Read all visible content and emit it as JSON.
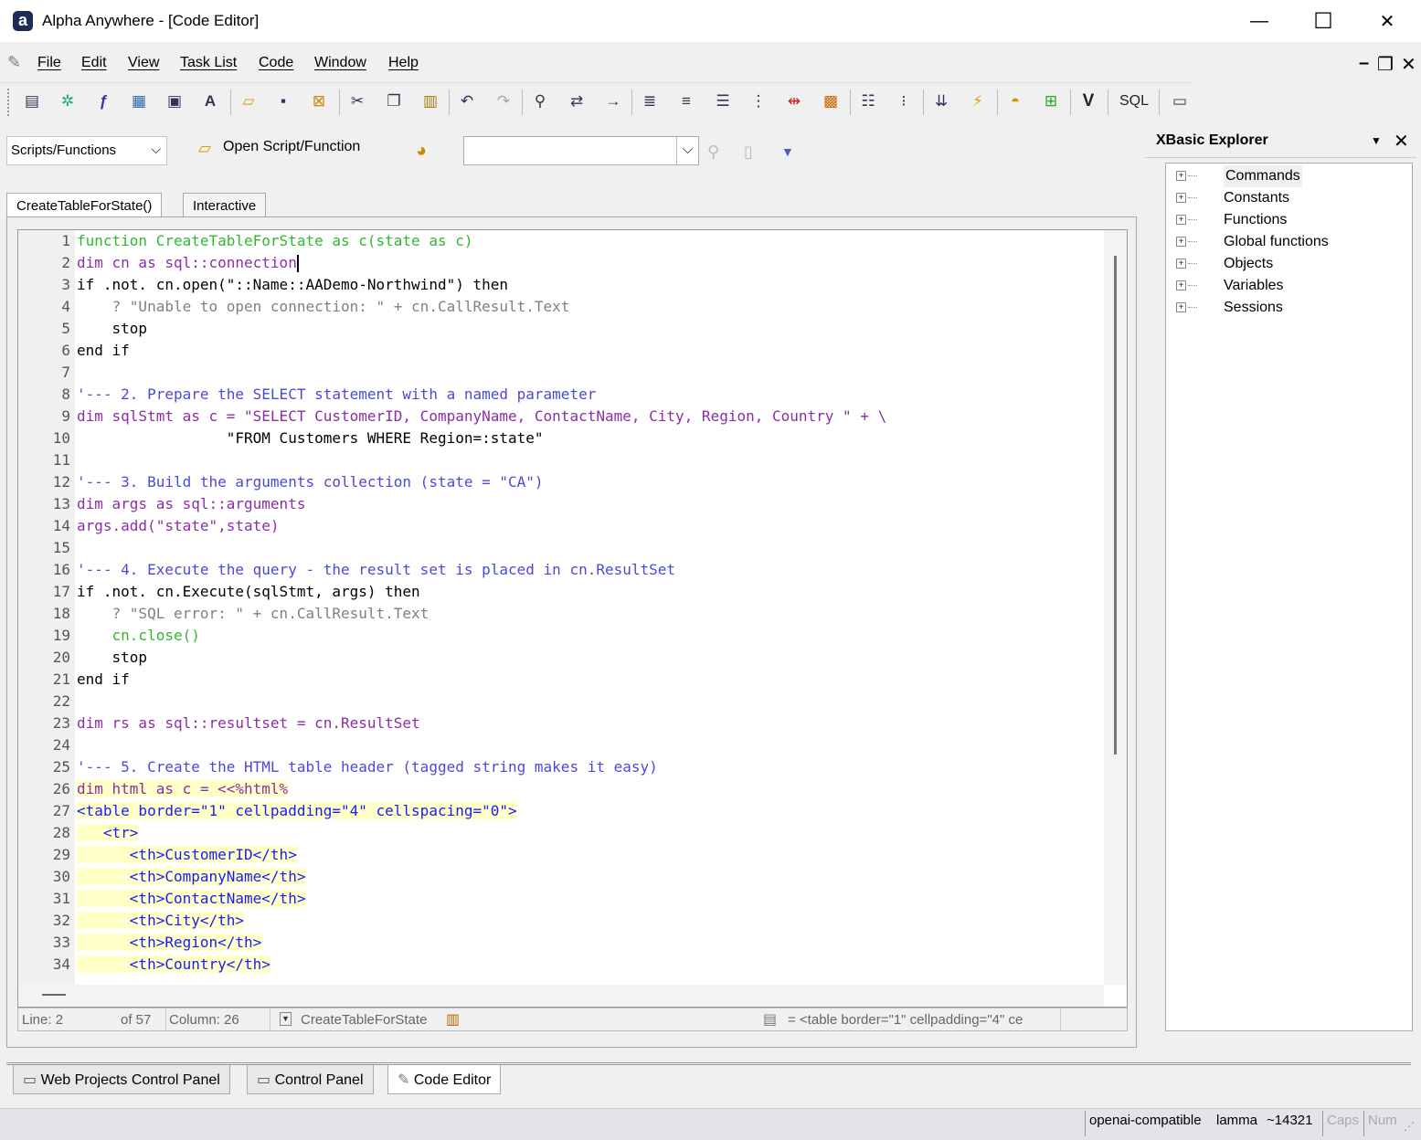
{
  "window": {
    "title": "Alpha Anywhere - [Code Editor]",
    "minimize_glyph": "—",
    "maximize_glyph": "☐",
    "close_glyph": "✕"
  },
  "menu": {
    "items": [
      {
        "label": "File"
      },
      {
        "label": "Edit"
      },
      {
        "label": "View"
      },
      {
        "label": "Task List"
      },
      {
        "label": "Code"
      },
      {
        "label": "Window"
      },
      {
        "label": "Help"
      }
    ],
    "mdi_min": "–",
    "mdi_restore": "❐",
    "mdi_close": "✕"
  },
  "toolbar": {
    "icons": [
      "new-script-icon",
      "new-function-icon",
      "function-icon",
      "class-icon",
      "properties-icon",
      "font-icon",
      "open-folder-icon",
      "save-icon",
      "save-close-icon",
      "cut-icon",
      "copy-icon",
      "paste-icon",
      "undo-icon",
      "redo-icon",
      "find-icon",
      "replace-icon",
      "goto-icon",
      "indent-icon",
      "outdent-icon",
      "format-icon",
      "align-right-icon",
      "split-icon",
      "tools-icon",
      "list-icon",
      "numbered-list-icon",
      "collapse-icon",
      "lightning-icon",
      "genie-icon",
      "add-icon",
      "verify-icon",
      "sql-icon",
      "window-icon"
    ],
    "v_label": "V",
    "sql_label": "SQL"
  },
  "editor_toolbar": {
    "scripts_select": "Scripts/Functions",
    "open_script": "Open Script/Function",
    "code_combo_value": ""
  },
  "tabs": [
    {
      "label": "CreateTableForState()",
      "active": true
    },
    {
      "label": "Interactive",
      "active": false
    }
  ],
  "code": {
    "line_numbers": [
      "1",
      "2",
      "3",
      "4",
      "5",
      "6",
      "7",
      "8",
      "9",
      "10",
      "11",
      "12",
      "13",
      "14",
      "15",
      "16",
      "17",
      "18",
      "19",
      "20",
      "21",
      "22",
      "23",
      "24",
      "25",
      "26",
      "27",
      "28",
      "29",
      "30",
      "31",
      "32",
      "33",
      "34"
    ],
    "lines": [
      "function CreateTableForState as c(state as c)",
      "dim cn as sql::connection",
      "if .not. cn.open(\"::Name::AADemo-Northwind\") then",
      "    ? \"Unable to open connection: \" + cn.CallResult.Text",
      "    stop",
      "end if",
      "",
      "'--- 2. Prepare the SELECT statement with a named parameter",
      "dim sqlStmt as c = \"SELECT CustomerID, CompanyName, ContactName, City, Region, Country \" + \\",
      "                 \"FROM Customers WHERE Region=:state\"",
      "",
      "'--- 3. Build the arguments collection (state = \"CA\")",
      "dim args as sql::arguments",
      "args.add(\"state\",state)",
      "",
      "'--- 4. Execute the query - the result set is placed in cn.ResultSet",
      "if .not. cn.Execute(sqlStmt, args) then",
      "    ? \"SQL error: \" + cn.CallResult.Text",
      "    cn.close()",
      "    stop",
      "end if",
      "",
      "dim rs as sql::resultset = cn.ResultSet",
      "",
      "'--- 5. Create the HTML table header (tagged string makes it easy)",
      "dim html as c = <<%html%",
      "<table border=\"1\" cellpadding=\"4\" cellspacing=\"0\">",
      "   <tr>",
      "      <th>CustomerID</th>",
      "      <th>CompanyName</th>",
      "      <th>ContactName</th>",
      "      <th>City</th>",
      "      <th>Region</th>",
      "      <th>Country</th>"
    ]
  },
  "editor_status": {
    "line": "Line: 2",
    "of": "of 57",
    "column": "Column: 26",
    "function": "CreateTableForState",
    "preview": "= <table border=\"1\" cellpadding=\"4\" ce"
  },
  "xbasic_explorer": {
    "title": "XBasic Explorer",
    "items": [
      "Commands",
      "Constants",
      "Functions",
      "Global functions",
      "Objects",
      "Variables",
      "Sessions"
    ]
  },
  "bottom_tabs": [
    {
      "label": "Web Projects Control Panel"
    },
    {
      "label": "Control Panel"
    },
    {
      "label": "Code Editor",
      "active": true
    }
  ],
  "status": {
    "provider": "openai-compatible",
    "model": "lamma",
    "tokens": "~14321",
    "caps": "Caps",
    "num": "Num"
  }
}
